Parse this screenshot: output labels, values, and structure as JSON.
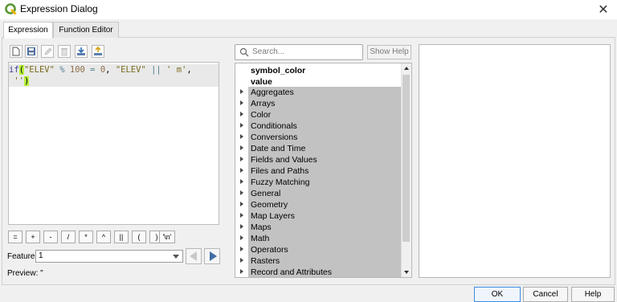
{
  "window": {
    "title": "Expression Dialog"
  },
  "tabs": [
    {
      "label": "Expression"
    },
    {
      "label": "Function Editor"
    }
  ],
  "editor": {
    "line1": {
      "p1": "if",
      "p2": "(",
      "p3": "\"ELEV\"",
      "p4": " % ",
      "p5": "100",
      "p6": " = ",
      "p7": "0",
      "p8": ", ",
      "p9": "\"ELEV\"",
      "p10": " || ",
      "p11": "' m'",
      "p12": ","
    },
    "line2": {
      "p1": " ",
      "p2": "''",
      "p3": ")"
    }
  },
  "operators": [
    "=",
    "+",
    "-",
    "/",
    "*",
    "^",
    "||",
    "(",
    ")",
    "'\\n'"
  ],
  "feature": {
    "label": "Feature",
    "value": "1"
  },
  "preview": {
    "label": "Preview:",
    "value": "\""
  },
  "search": {
    "placeholder": "Search..."
  },
  "show_help": "Show Help",
  "tree": {
    "items": [
      "symbol_color",
      "value"
    ],
    "groups": [
      "Aggregates",
      "Arrays",
      "Color",
      "Conditionals",
      "Conversions",
      "Date and Time",
      "Fields and Values",
      "Files and Paths",
      "Fuzzy Matching",
      "General",
      "Geometry",
      "Map Layers",
      "Maps",
      "Math",
      "Operators",
      "Rasters",
      "Record and Attributes"
    ]
  },
  "buttons": {
    "ok": "OK",
    "cancel": "Cancel",
    "help": "Help"
  },
  "colors": {
    "highlight": "#b8f23a",
    "group_bg": "#c2c2c2",
    "ok_border": "#3c8de0"
  }
}
